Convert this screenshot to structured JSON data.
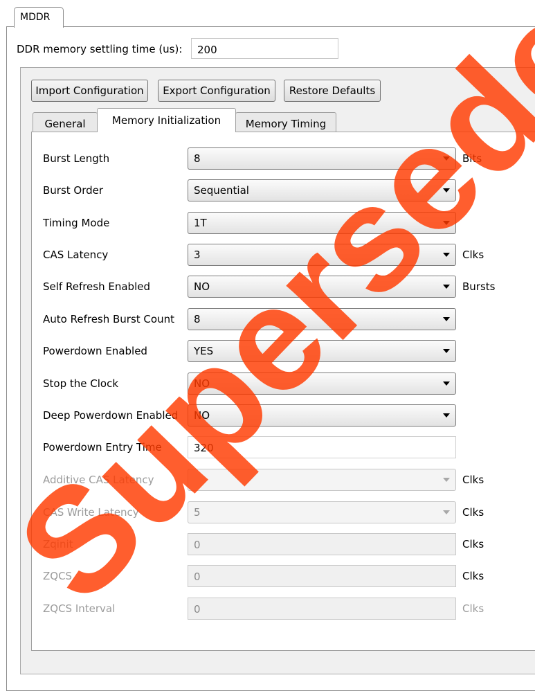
{
  "outer_tab": {
    "label": "MDDR"
  },
  "settling": {
    "label": "DDR memory settling time (us):",
    "value": "200"
  },
  "buttons": {
    "import": "Import Configuration",
    "export": "Export Configuration",
    "restore": "Restore Defaults"
  },
  "tabs": [
    {
      "label": "General",
      "active": false
    },
    {
      "label": "Memory Initialization",
      "active": true
    },
    {
      "label": "Memory Timing",
      "active": false
    }
  ],
  "rows": [
    {
      "label": "Burst Length",
      "type": "combo",
      "value": "8",
      "unit": "Bits",
      "enabled": true
    },
    {
      "label": "Burst Order",
      "type": "combo",
      "value": "Sequential",
      "unit": "",
      "enabled": true
    },
    {
      "label": "Timing Mode",
      "type": "combo",
      "value": "1T",
      "unit": "",
      "enabled": true
    },
    {
      "label": "CAS Latency",
      "type": "combo",
      "value": "3",
      "unit": "Clks",
      "enabled": true
    },
    {
      "label": "Self Refresh Enabled",
      "type": "combo",
      "value": "NO",
      "unit": "Bursts",
      "enabled": true
    },
    {
      "label": "Auto Refresh Burst Count",
      "type": "combo",
      "value": "8",
      "unit": "",
      "enabled": true
    },
    {
      "label": "Powerdown Enabled",
      "type": "combo",
      "value": "YES",
      "unit": "",
      "enabled": true
    },
    {
      "label": "Stop the Clock",
      "type": "combo",
      "value": "NO",
      "unit": "",
      "enabled": true
    },
    {
      "label": "Deep Powerdown Enabled",
      "type": "combo",
      "value": "NO",
      "unit": "",
      "enabled": true
    },
    {
      "label": "Powerdown Entry Time",
      "type": "text",
      "value": "320",
      "unit": "",
      "enabled": true
    },
    {
      "label": "Additive CAS Latency",
      "type": "combo",
      "value": "",
      "unit": "Clks",
      "enabled": false
    },
    {
      "label": "CAS Write  Latency",
      "type": "combo",
      "value": "5",
      "unit": "Clks",
      "enabled": false
    },
    {
      "label": "Zqinit",
      "type": "text",
      "value": "0",
      "unit": "Clks",
      "enabled": false
    },
    {
      "label": "ZQCS",
      "type": "text",
      "value": "0",
      "unit": "Clks",
      "enabled": false
    },
    {
      "label": "ZQCS Interval",
      "type": "text",
      "value": "0",
      "unit": "Clks",
      "enabled": false
    }
  ],
  "watermark": {
    "text": "Superseded",
    "color": "#ff3b00"
  }
}
